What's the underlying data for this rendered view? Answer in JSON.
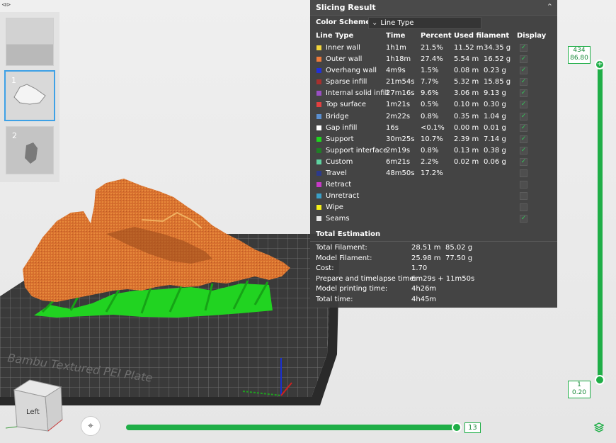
{
  "panel": {
    "title": "Slicing Result",
    "color_scheme_label": "Color Scheme",
    "color_scheme_value": "Line Type",
    "columns": {
      "line_type": "Line Type",
      "time": "Time",
      "percent": "Percent",
      "used_filament": "Used filament",
      "display": "Display"
    },
    "rows": [
      {
        "name": "Inner wall",
        "time": "1h1m",
        "percent": "21.5%",
        "length": "11.52 m",
        "weight": "34.35 g",
        "color": "#f2d53a",
        "checked": true
      },
      {
        "name": "Outer wall",
        "time": "1h18m",
        "percent": "27.4%",
        "length": "5.54 m",
        "weight": "16.52 g",
        "color": "#ee7a3a",
        "checked": true
      },
      {
        "name": "Overhang wall",
        "time": "4m9s",
        "percent": "1.5%",
        "length": "0.08 m",
        "weight": "0.23 g",
        "color": "#2230d8",
        "checked": true
      },
      {
        "name": "Sparse infill",
        "time": "21m54s",
        "percent": "7.7%",
        "length": "5.32 m",
        "weight": "15.85 g",
        "color": "#a8302e",
        "checked": true
      },
      {
        "name": "Internal solid infill",
        "time": "27m16s",
        "percent": "9.6%",
        "length": "3.06 m",
        "weight": "9.13 g",
        "color": "#9a4fc4",
        "checked": true
      },
      {
        "name": "Top surface",
        "time": "1m21s",
        "percent": "0.5%",
        "length": "0.10 m",
        "weight": "0.30 g",
        "color": "#e24040",
        "checked": true
      },
      {
        "name": "Bridge",
        "time": "2m22s",
        "percent": "0.8%",
        "length": "0.35 m",
        "weight": "1.04 g",
        "color": "#5a8fd0",
        "checked": true
      },
      {
        "name": "Gap infill",
        "time": "16s",
        "percent": "<0.1%",
        "length": "0.00 m",
        "weight": "0.01 g",
        "color": "#ffffff",
        "checked": true
      },
      {
        "name": "Support",
        "time": "30m25s",
        "percent": "10.7%",
        "length": "2.39 m",
        "weight": "7.14 g",
        "color": "#1fd51f",
        "checked": true
      },
      {
        "name": "Support interface",
        "time": "2m19s",
        "percent": "0.8%",
        "length": "0.13 m",
        "weight": "0.38 g",
        "color": "#1f7f26",
        "checked": true
      },
      {
        "name": "Custom",
        "time": "6m21s",
        "percent": "2.2%",
        "length": "0.02 m",
        "weight": "0.06 g",
        "color": "#5fd3a0",
        "checked": true
      },
      {
        "name": "Travel",
        "time": "48m50s",
        "percent": "17.2%",
        "length": "",
        "weight": "",
        "color": "#2c3a8c",
        "checked": false
      },
      {
        "name": "Retract",
        "time": "",
        "percent": "",
        "length": "",
        "weight": "",
        "color": "#c73ac7",
        "checked": false
      },
      {
        "name": "Unretract",
        "time": "",
        "percent": "",
        "length": "",
        "weight": "",
        "color": "#3aa0c7",
        "checked": false
      },
      {
        "name": "Wipe",
        "time": "",
        "percent": "",
        "length": "",
        "weight": "",
        "color": "#f5f01a",
        "checked": false
      },
      {
        "name": "Seams",
        "time": "",
        "percent": "",
        "length": "",
        "weight": "",
        "color": "#e6e6e6",
        "checked": true
      }
    ],
    "total_title": "Total Estimation",
    "totals": [
      {
        "label": "Total Filament:",
        "value": "28.51 m",
        "extra": "85.02 g"
      },
      {
        "label": "Model Filament:",
        "value": "25.98 m",
        "extra": "77.50 g"
      },
      {
        "label": "Cost:",
        "value": "1.70",
        "extra": ""
      },
      {
        "label": "Prepare and timelapse time:",
        "value": "6m29s + 11m50s",
        "extra": ""
      },
      {
        "label": "Model printing time:",
        "value": "4h26m",
        "extra": ""
      },
      {
        "label": "Total time:",
        "value": "4h45m",
        "extra": ""
      }
    ]
  },
  "thumbnails": [
    {
      "number": ""
    },
    {
      "number": "1"
    },
    {
      "number": "2"
    }
  ],
  "layer_slider": {
    "top_layer": "434",
    "top_height": "86.80",
    "bottom_layer": "1",
    "bottom_height": "0.20"
  },
  "move_slider": {
    "value": "13"
  },
  "view_cube": {
    "face_label": "Left"
  },
  "plate_text": "Bambu Textured PEI Plate",
  "icons": {
    "collapse": "chevron-up-icon",
    "camera": "camera-focus-icon",
    "layers": "layers-icon"
  }
}
